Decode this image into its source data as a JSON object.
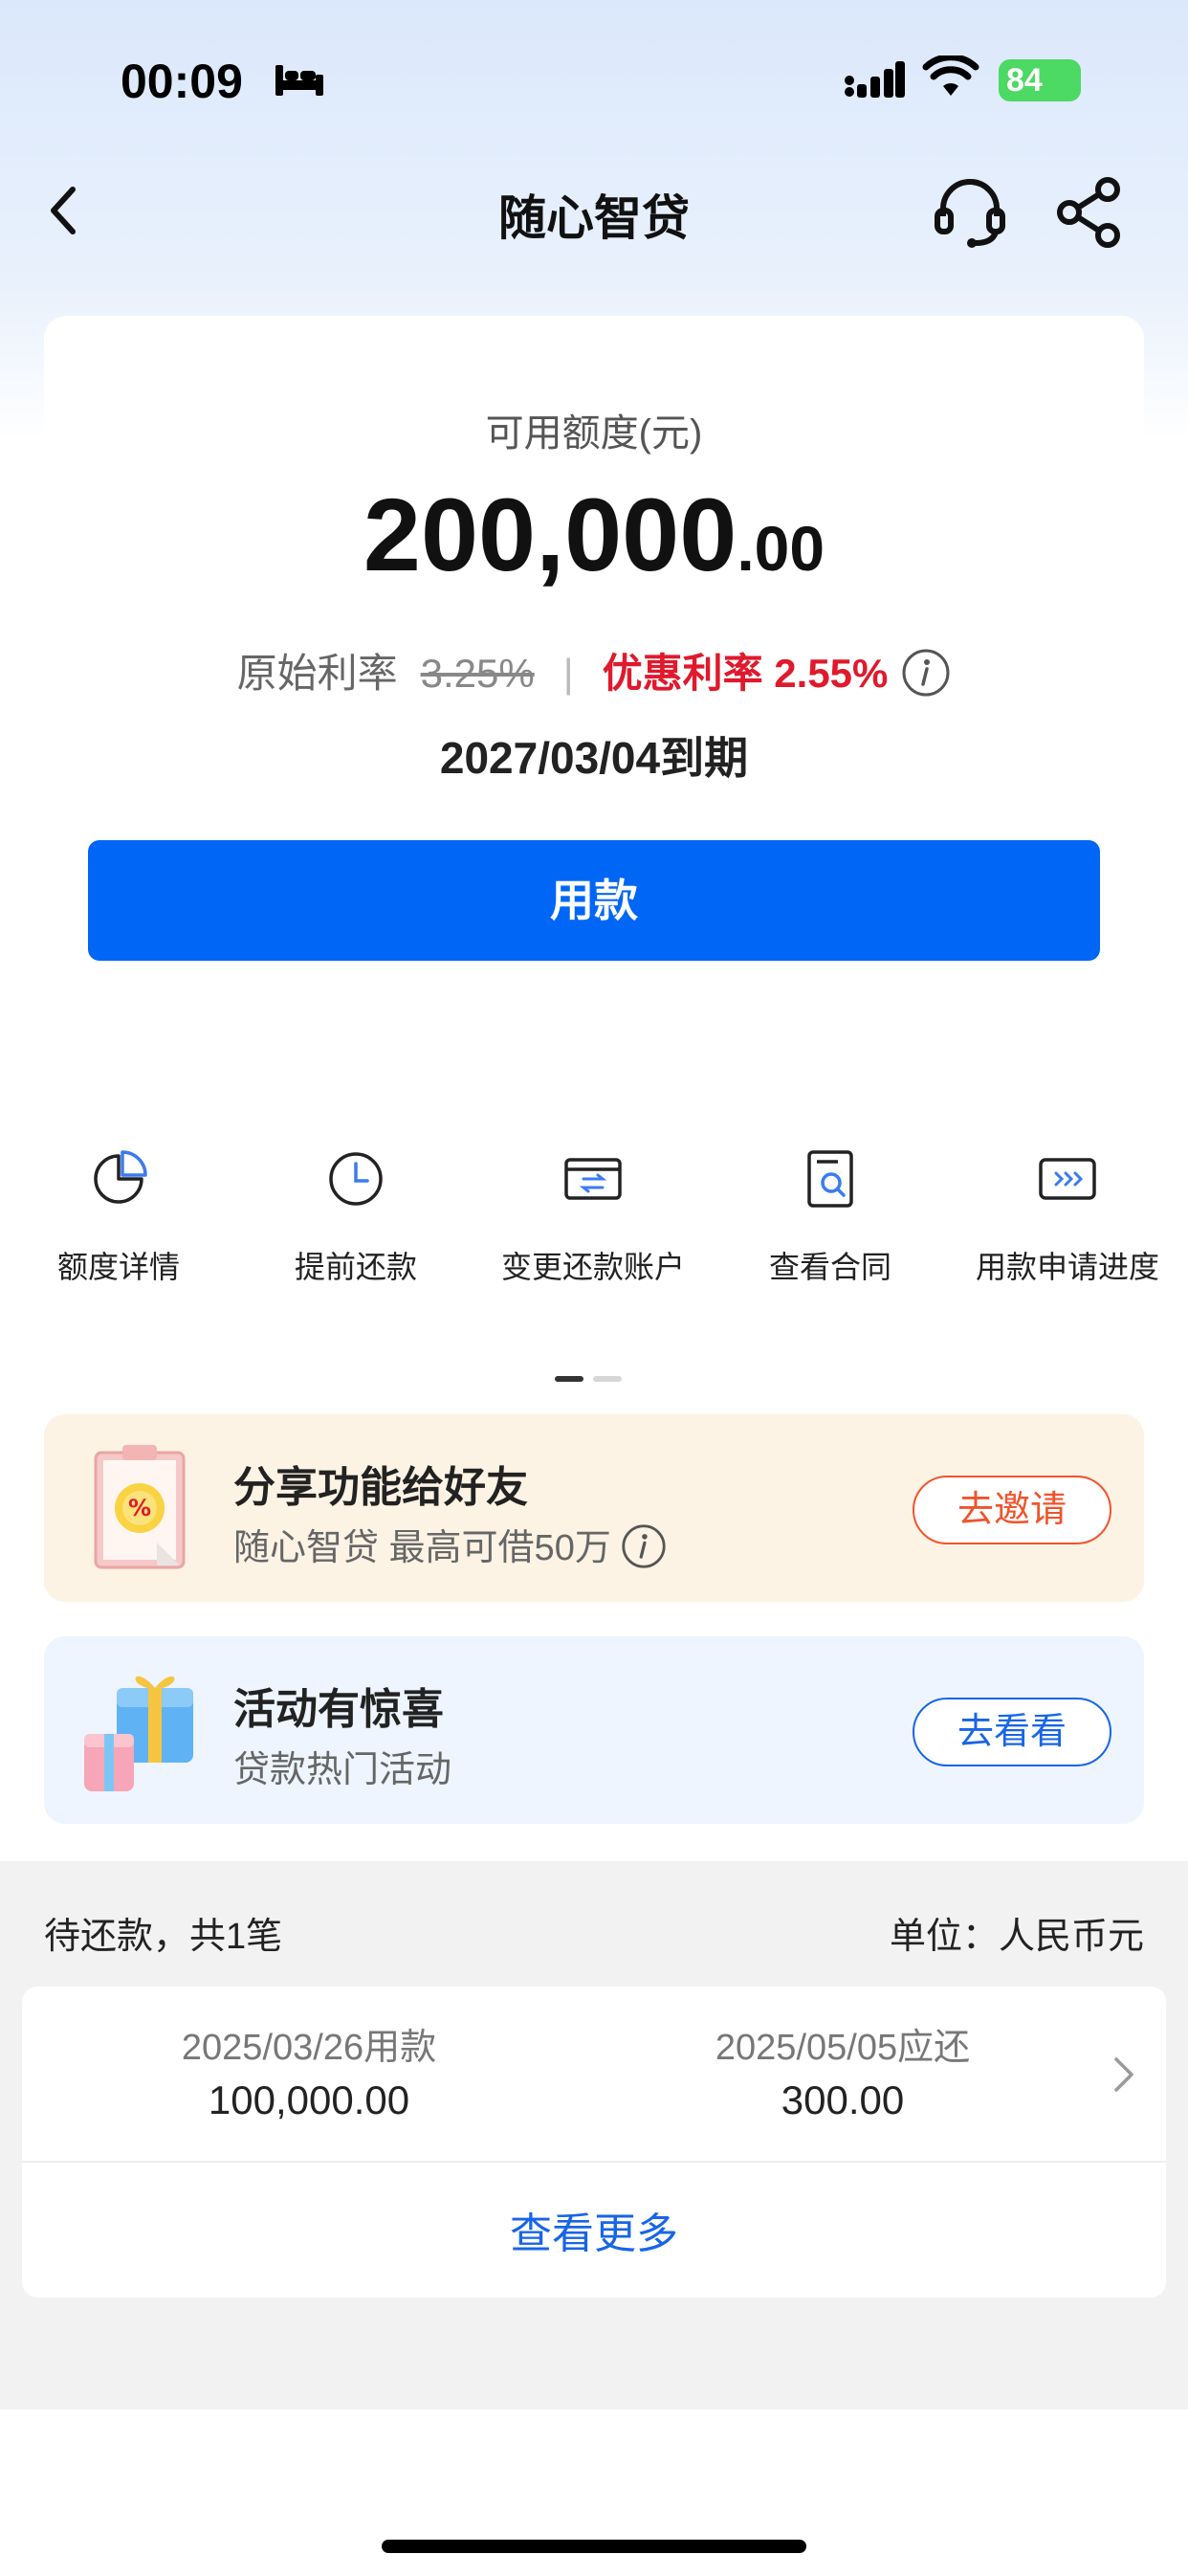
{
  "status_bar": {
    "time": "00:09",
    "battery": "84"
  },
  "nav": {
    "title": "随心智贷"
  },
  "credit": {
    "label": "可用额度(元)",
    "amount_integer": "200,000",
    "amount_decimal": ".00",
    "original_rate_label": "原始利率",
    "original_rate": "3.25%",
    "separator": "|",
    "promo_rate": "优惠利率 2.55%",
    "due_date": "2027/03/04到期",
    "use_button": "用款"
  },
  "quick_menu": [
    {
      "label": "额度详情",
      "icon": "pie-chart-icon"
    },
    {
      "label": "提前还款",
      "icon": "clock-icon"
    },
    {
      "label": "变更还款账户",
      "icon": "card-switch-icon"
    },
    {
      "label": "查看合同",
      "icon": "contract-search-icon"
    },
    {
      "label": "用款申请进度",
      "icon": "progress-icon"
    }
  ],
  "banners": {
    "share": {
      "title": "分享功能给好友",
      "subtitle": "随心智贷 最高可借50万",
      "button": "去邀请"
    },
    "event": {
      "title": "活动有惊喜",
      "subtitle": "贷款热门活动",
      "button": "去看看"
    }
  },
  "pending": {
    "title": "待还款，共1笔",
    "unit": "单位：人民币元",
    "loan": {
      "borrow_caption": "2025/03/26用款",
      "borrow_amount": "100,000.00",
      "due_caption": "2025/05/05应还",
      "due_amount": "300.00"
    },
    "more": "查看更多"
  },
  "colors": {
    "primary": "#0066f5",
    "promo_red": "#e0192c",
    "invite_orange": "#f0542c",
    "link_blue": "#1765e8"
  }
}
